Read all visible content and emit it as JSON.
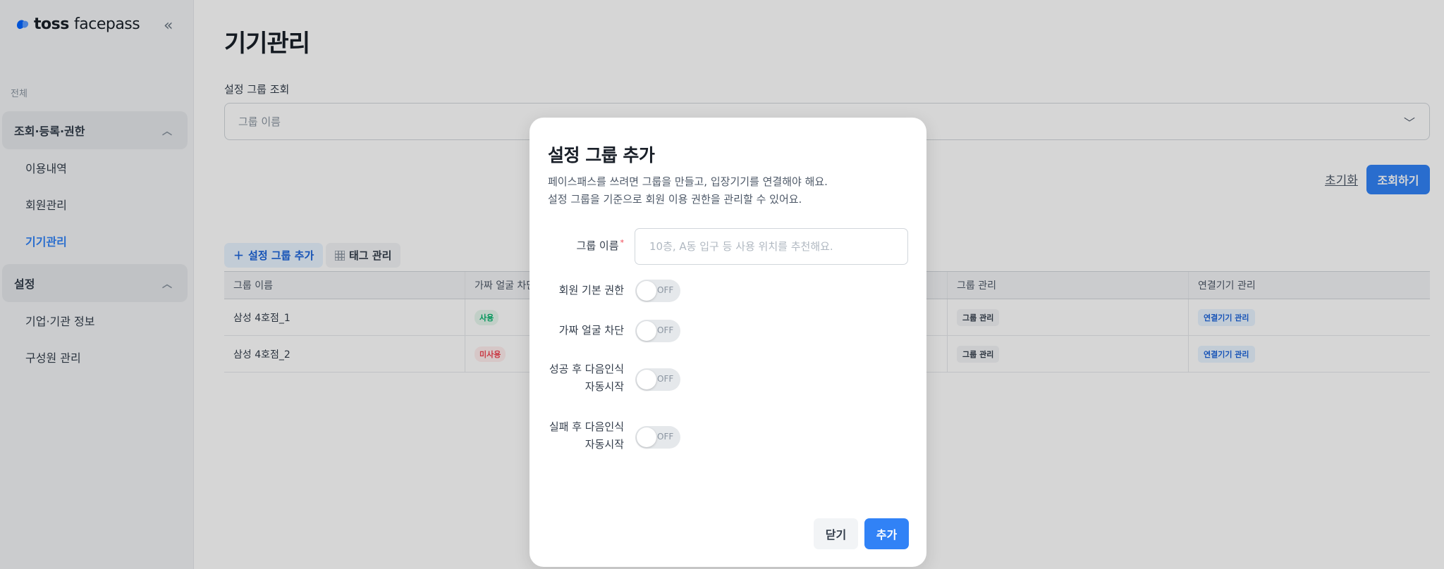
{
  "sidebar": {
    "brand": "toss",
    "brand_suffix": "facepass",
    "section_all": "전체",
    "groups": [
      {
        "label": "조회·등록·권한",
        "items": [
          "이용내역",
          "회원관리",
          "기기관리"
        ]
      },
      {
        "label": "설정",
        "items": [
          "기업·기관 정보",
          "구성원 관리"
        ]
      }
    ]
  },
  "main": {
    "title": "기기관리",
    "search_label": "설정 그룹 조회",
    "select_placeholder": "그룹 이름",
    "reset": "초기화",
    "search_button": "조회하기",
    "add_group_button": "설정 그룹 추가",
    "tag_manage_button": "태그 관리",
    "table": {
      "columns": [
        "그룹 이름",
        "가짜 얼굴 차단",
        "",
        "",
        "그룹 관리",
        "연결기기 관리"
      ],
      "rows": [
        {
          "name": "삼성 4호점_1",
          "fake_block": "사용",
          "group_manage": "그룹 관리",
          "device_manage": "연결기기 관리"
        },
        {
          "name": "삼성 4호점_2",
          "fake_block": "미사용",
          "group_manage": "그룹 관리",
          "device_manage": "연결기기 관리"
        }
      ]
    }
  },
  "modal": {
    "title": "설정 그룹 추가",
    "desc_line1": "페이스패스를 쓰려면 그룹을 만들고, 입장기기를 연결해야 해요.",
    "desc_line2": "설정 그룹을 기준으로 회원 이용 권한을 관리할 수 있어요.",
    "group_name_label": "그룹 이름",
    "required_mark": "*",
    "group_name_placeholder": "10층, A동 입구 등 사용 위치를 추천해요.",
    "group_name_value": "",
    "toggles": [
      {
        "label_line1": "회원 기본 권한",
        "label_line2": "",
        "state": "OFF"
      },
      {
        "label_line1": "가짜 얼굴 차단",
        "label_line2": "",
        "state": "OFF"
      },
      {
        "label_line1": "성공 후 다음인식",
        "label_line2": "자동시작",
        "state": "OFF"
      },
      {
        "label_line1": "실패 후 다음인식",
        "label_line2": "자동시작",
        "state": "OFF"
      }
    ],
    "close_button": "닫기",
    "add_button": "추가"
  },
  "colors": {
    "accent": "#3182f6",
    "overlay": "rgba(0,0,0,0.16)"
  },
  "icons": [
    "toss-logo-icon",
    "collapse-sidebar-icon",
    "chevron-up-icon",
    "chevron-down-icon",
    "plus-icon",
    "grid-icon"
  ]
}
